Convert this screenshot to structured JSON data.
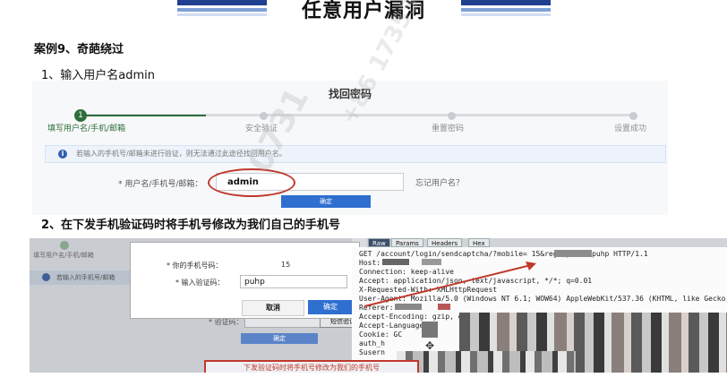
{
  "header": {
    "title": "任意用户漏洞"
  },
  "case_title": "案例9、奇葩绕过",
  "step1": "1、输入用户名admin",
  "step2": "2、在下发手机验证码时将手机号修改为我们自己的手机号",
  "shot1": {
    "heading": "找回密码",
    "steps": [
      {
        "num": "1",
        "label": "填写用户名/手机/邮箱",
        "active": true
      },
      {
        "label": "安全验证",
        "active": false
      },
      {
        "label": "重置密码",
        "active": false
      },
      {
        "label": "设置成功",
        "active": false
      }
    ],
    "info": "若输入的手机号/邮箱未进行验证，则无法通过此途径找回用户名。",
    "username_label": "* 用户名/手机号/邮箱：",
    "username_value": "admin",
    "forgot_link": "忘记用户名？",
    "confirm": "确定"
  },
  "shot2": {
    "bg_step_label": "填写用户名/手机/邮箱",
    "bg_info": "若输入的手机号/邮箱",
    "phone_label": "* 你的手机号码：",
    "phone_value": "15",
    "code_label": "* 输入验证码：",
    "code_value": "puhp",
    "cancel": "取消",
    "ok": "确定",
    "bg_verify_label": "* 验证码：",
    "bg_sms_button": "短信验证",
    "bg_confirm": "确定",
    "tabs": [
      "Raw",
      "Params",
      "Headers",
      "Hex"
    ],
    "request_lines": [
      "GET /account/login/sendcaptcha/?mobile=            15&regcaptcha=puhp HTTP/1.1",
      "Host:",
      "Connection: keep-alive",
      "Accept: application/json, text/javascript, */*; q=0.01",
      "X-Requested-With: XMLHttpRequest",
      "User-Agent: Mozilla/5.0 (Windows NT 6.1; WOW64) AppleWebKit/537.36 (KHTML, like Gecko) C",
      "Referer:",
      "Accept-Encoding: gzip, deflate, sdch",
      "Accept-Language:",
      "Cookie: GC",
      "auth_h",
      "Susern"
    ],
    "caption": "下发验证码时将手机号修改为我们的手机号"
  },
  "watermark": "0731",
  "watermark_phone": "+86 17353425314"
}
